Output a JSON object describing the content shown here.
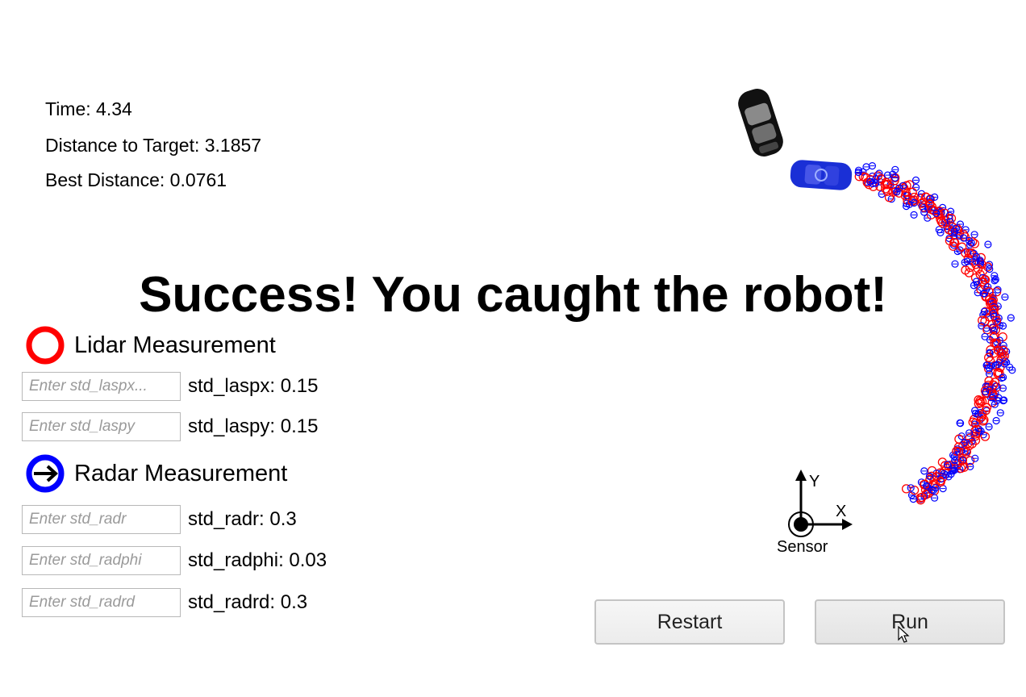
{
  "stats": {
    "time": "Time: 4.34",
    "distance": "Distance to Target: 3.1857",
    "best": "Best Distance: 0.0761"
  },
  "banner": "Success! You caught the robot!",
  "lidar": {
    "title": "Lidar Measurement",
    "color": "#ff0000",
    "params": [
      {
        "placeholder": "Enter std_laspx...",
        "label": "std_laspx: 0.15"
      },
      {
        "placeholder": "Enter std_laspy",
        "label": "std_laspy: 0.15"
      }
    ]
  },
  "radar": {
    "title": "Radar Measurement",
    "color": "#0000ff",
    "params": [
      {
        "placeholder": "Enter std_radr",
        "label": "std_radr: 0.3"
      },
      {
        "placeholder": "Enter std_radphi",
        "label": "std_radphi: 0.03"
      },
      {
        "placeholder": "Enter std_radrd",
        "label": "std_radrd: 0.3"
      }
    ]
  },
  "axes": {
    "x": "X",
    "y": "Y",
    "sensor": "Sensor"
  },
  "buttons": {
    "restart": "Restart",
    "run": "Run"
  },
  "colors": {
    "hunter_car": "#111111",
    "target_car": "#1a2fd6"
  }
}
